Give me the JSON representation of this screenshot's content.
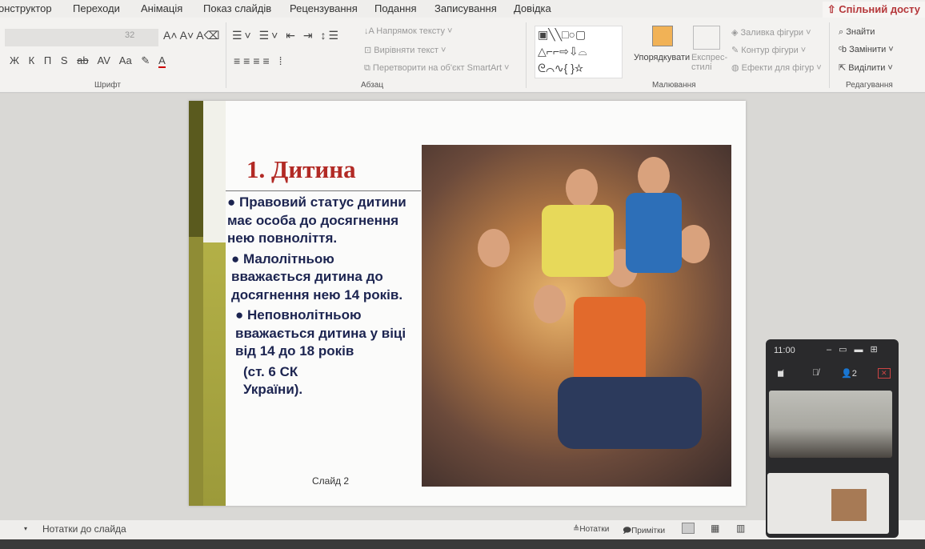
{
  "tabs": [
    "онструктор",
    "Переходи",
    "Анімація",
    "Показ слайдів",
    "Рецензування",
    "Подання",
    "Записування",
    "Довідка"
  ],
  "share_label": "Спільний досту",
  "ribbon": {
    "font_size": "32",
    "font_buttons": [
      "Ж",
      "К",
      "П",
      "S",
      "ab",
      "AV",
      "Aa"
    ],
    "font_group": "Шрифт",
    "text_direction": "Напрямок тексту",
    "align_text": "Вирівняти текст",
    "smartart": "Перетворити на об'єкт SmartArt",
    "paragraph_group": "Абзац",
    "arrange": "Упорядкувати",
    "quick_styles": "Експрес-стилі",
    "shape_fill": "Заливка фігури",
    "shape_outline": "Контур фігури",
    "shape_effects": "Ефекти для фігур",
    "drawing_group": "Малювання",
    "find": "Знайти",
    "replace": "Замінити",
    "select": "Виділити",
    "editing_group": "Редагування"
  },
  "slide": {
    "title": "1. Дитина",
    "bullets": [
      "● Правовий статус дитини має особа до досягнення нею повноліття.",
      "● Малолітньою вважається дитина до досягнення нею 14 років.",
      "● Неповнолітньою вважається дитина  у віці від 14 до 18 років"
    ],
    "reference": "(ст. 6 СК України).",
    "number": "Слайд 2"
  },
  "notes": {
    "placeholder": "Нотатки до слайда",
    "notes_button": "Нотатки",
    "comments_button": "Примітки"
  },
  "video_call": {
    "time": "11:00",
    "participants": "2"
  }
}
